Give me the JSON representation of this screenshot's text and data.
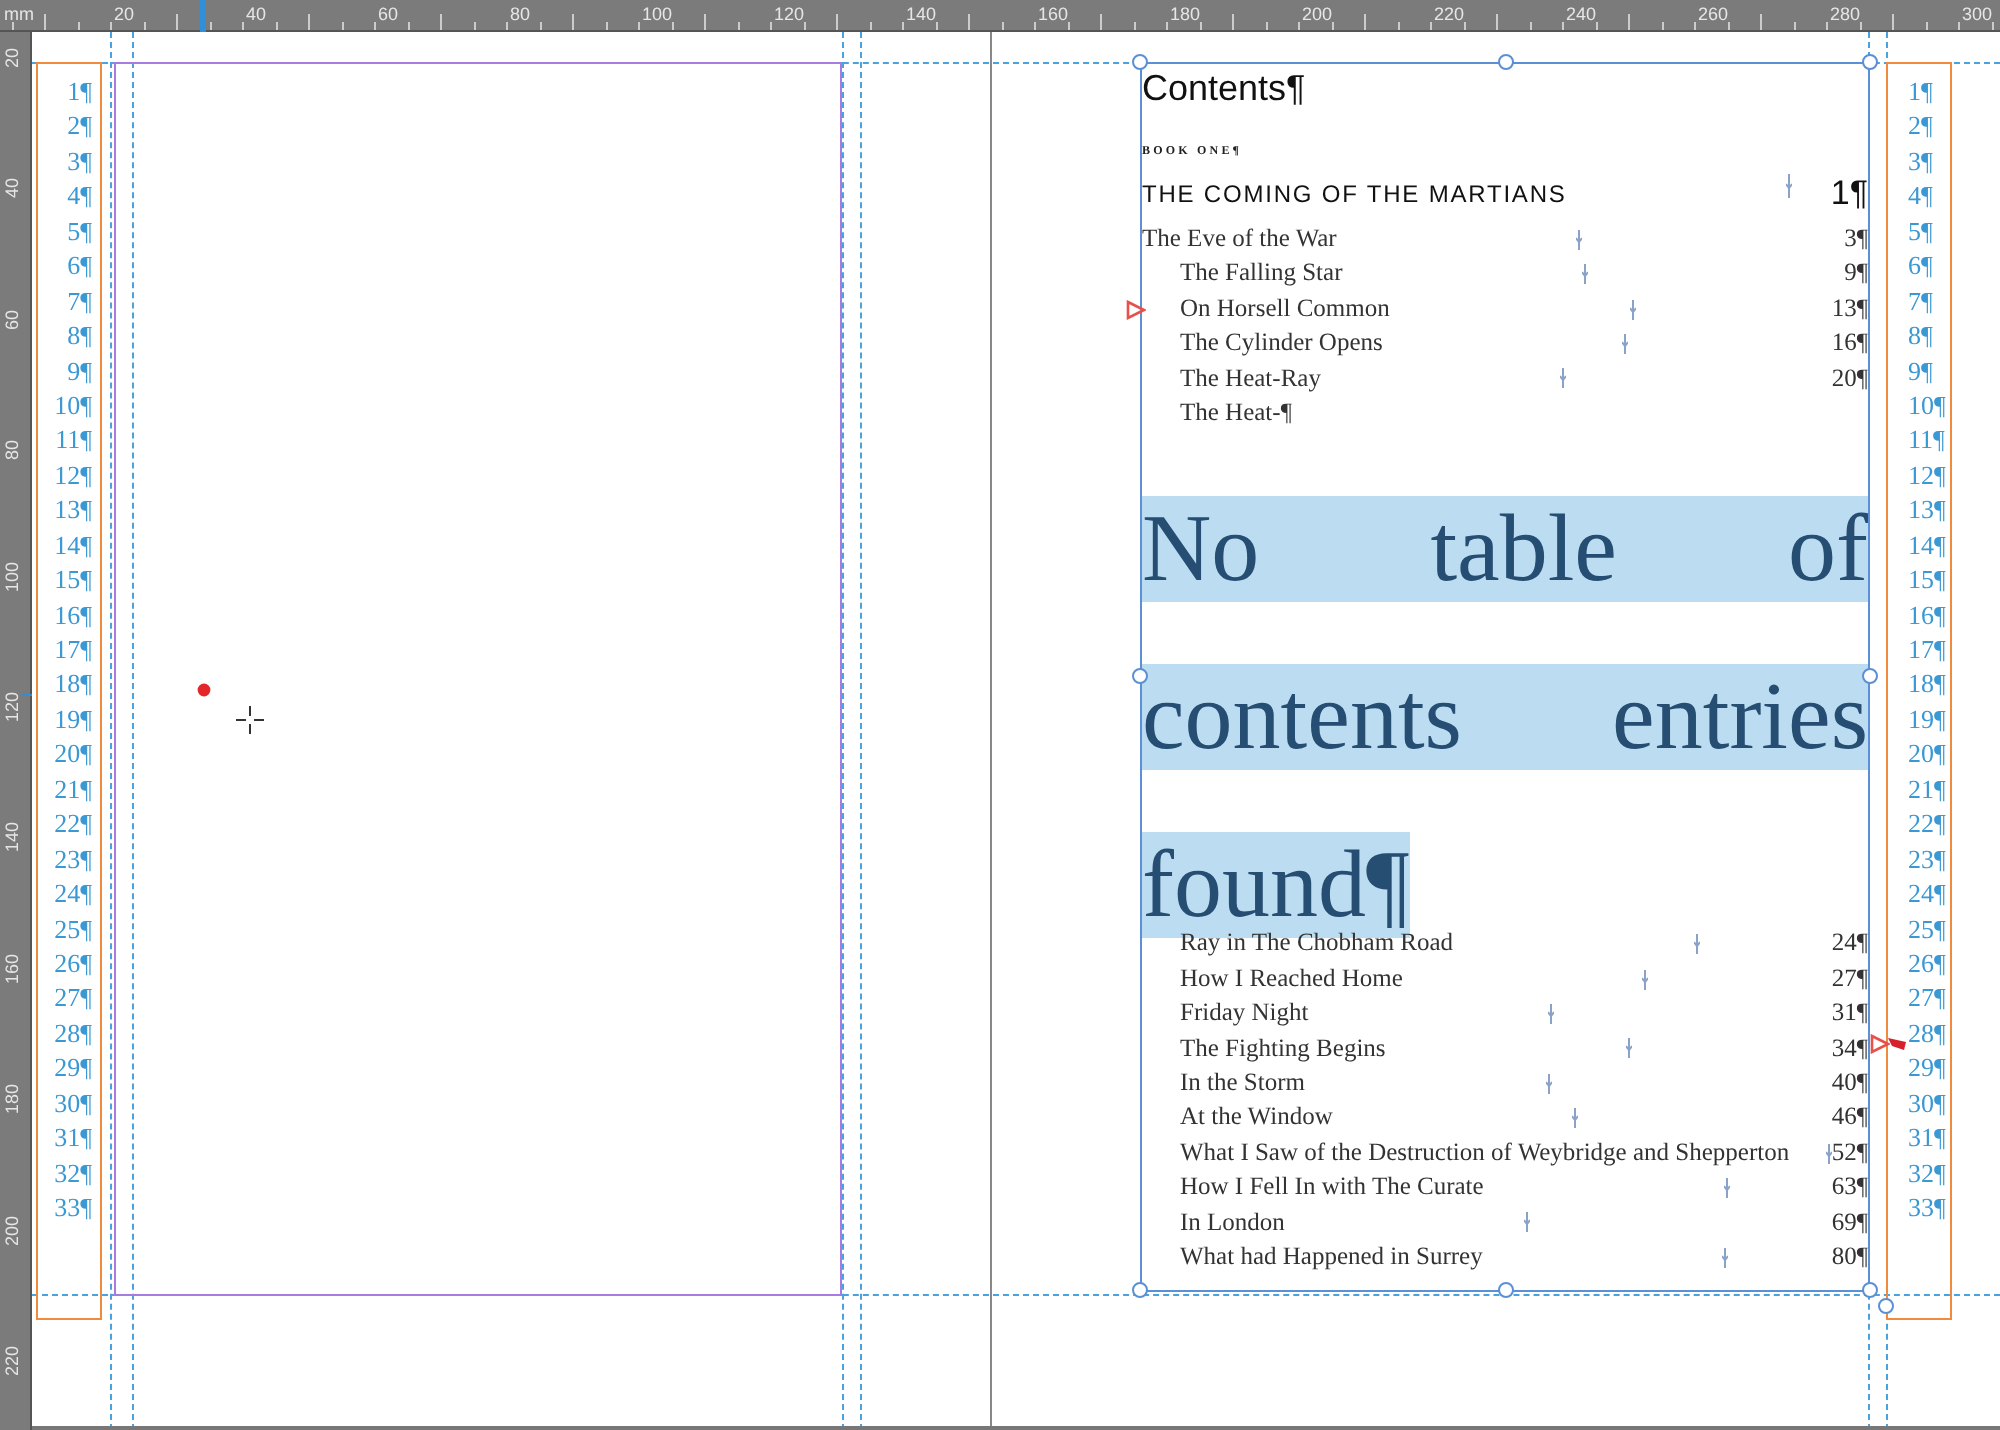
{
  "ruler": {
    "unit": "mm",
    "top_labels": [
      "20",
      "40",
      "60",
      "80",
      "100",
      "120",
      "140",
      "160",
      "180",
      "200",
      "220",
      "240",
      "260",
      "280",
      "300"
    ],
    "left_labels": [
      "20",
      "40",
      "60",
      "80",
      "100",
      "120",
      "140",
      "160",
      "180",
      "200",
      "220"
    ]
  },
  "left_page": {
    "line_numbers": [
      "1¶",
      "2¶",
      "3¶",
      "4¶",
      "5¶",
      "6¶",
      "7¶",
      "8¶",
      "9¶",
      "10¶",
      "11¶",
      "12¶",
      "13¶",
      "14¶",
      "15¶",
      "16¶",
      "17¶",
      "18¶",
      "19¶",
      "20¶",
      "21¶",
      "22¶",
      "23¶",
      "24¶",
      "25¶",
      "26¶",
      "27¶",
      "28¶",
      "29¶",
      "30¶",
      "31¶",
      "32¶",
      "33¶"
    ]
  },
  "right_page": {
    "toc": {
      "heading": "Contents¶",
      "book_label": "BOOK ONE¶",
      "part": {
        "title": "THE COMING OF THE MARTIANS",
        "page": "1¶"
      },
      "entries": [
        {
          "title": "The Eve of the War",
          "page": "3¶",
          "children": [
            {
              "title": "The Falling Star",
              "page": "9¶"
            },
            {
              "title": "On Horsell Common",
              "page": "13¶"
            },
            {
              "title": "The Cylinder Opens",
              "page": "16¶"
            },
            {
              "title": "The Heat-Ray",
              "page": "20¶"
            },
            {
              "title": "The Heat-¶"
            }
          ]
        }
      ],
      "message": {
        "text": "No table of contents entries found¶",
        "selected": true
      },
      "continued_entries": [
        {
          "title": "Ray in The Chobham Road",
          "page": "24¶"
        },
        {
          "title": "How I Reached Home",
          "page": "27¶"
        },
        {
          "title": "Friday Night",
          "page": "31¶"
        },
        {
          "title": "The Fighting Begins",
          "page": "34¶"
        },
        {
          "title": "In the Storm",
          "page": "40¶"
        },
        {
          "title": "At the Window",
          "page": "46¶"
        },
        {
          "title": "What I Saw of the Destruction of Weybridge and Shepperton",
          "page": "52¶"
        },
        {
          "title": "How I Fell In with The Curate",
          "page": "63¶"
        },
        {
          "title": "In London",
          "page": "69¶"
        },
        {
          "title": "What had Happened in Surrey",
          "page": "80¶"
        }
      ]
    },
    "line_numbers": [
      "1¶",
      "2¶",
      "3¶",
      "4¶",
      "5¶",
      "6¶",
      "7¶",
      "8¶",
      "9¶",
      "10¶",
      "11¶",
      "12¶",
      "13¶",
      "14¶",
      "15¶",
      "16¶",
      "17¶",
      "18¶",
      "19¶",
      "20¶",
      "21¶",
      "22¶",
      "23¶",
      "24¶",
      "25¶",
      "26¶",
      "27¶",
      "28¶",
      "29¶",
      "30¶",
      "31¶",
      "32¶",
      "33¶"
    ]
  }
}
